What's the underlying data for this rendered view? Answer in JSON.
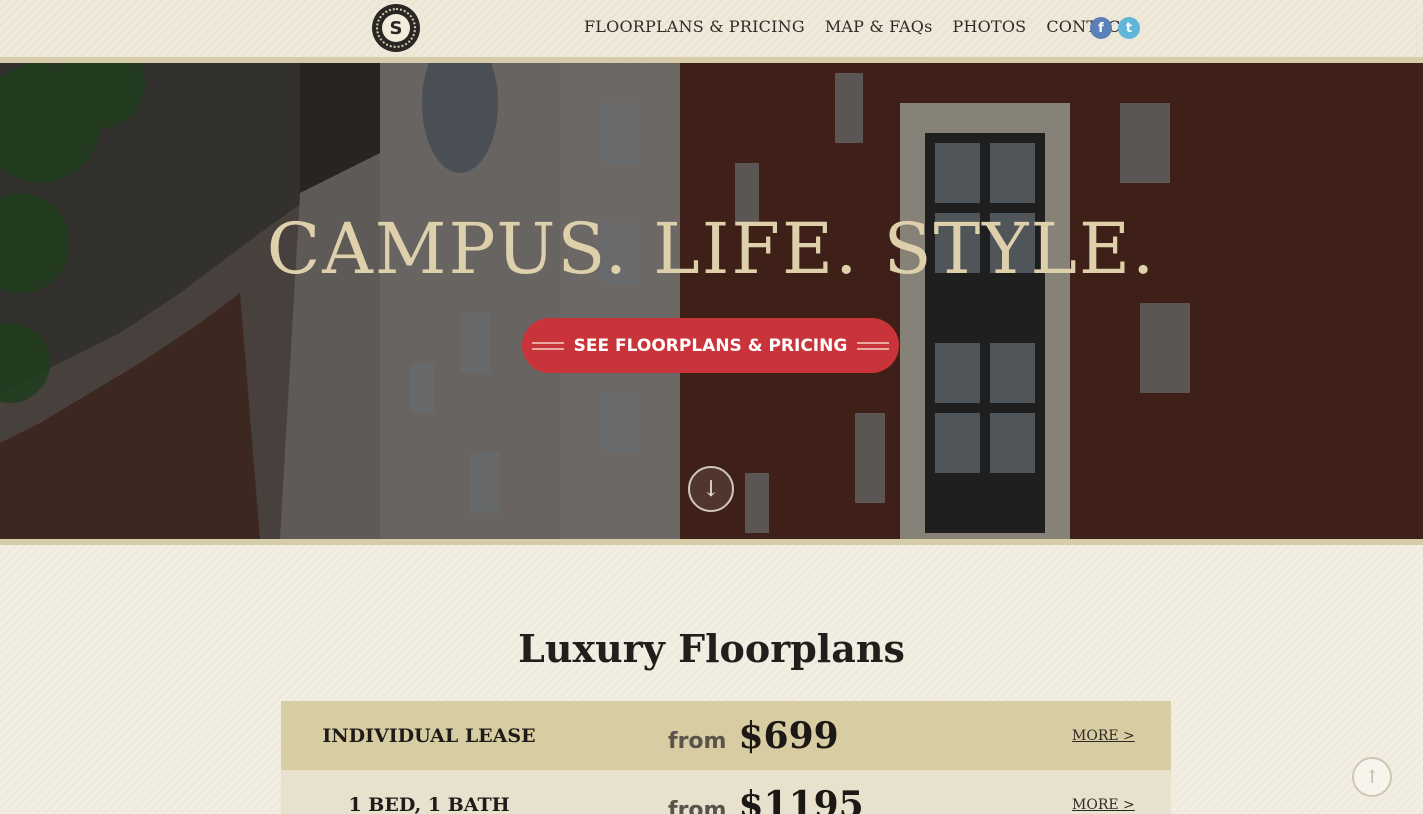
{
  "header": {
    "logo_letter": "S",
    "nav": [
      {
        "label": "FLOORPLANS & PRICING"
      },
      {
        "label": "MAP & FAQs"
      },
      {
        "label": "PHOTOS"
      },
      {
        "label": "CONTACT"
      }
    ],
    "social": {
      "facebook": "f",
      "twitter": "t"
    }
  },
  "hero": {
    "title": "CAMPUS. LIFE. STYLE.",
    "cta_label": "SEE FLOORPLANS & PRICING",
    "scroll_icon": "arrow-down-circle-icon"
  },
  "floorplans": {
    "title": "Luxury Floorplans",
    "plans": [
      {
        "name": "INDIVIDUAL LEASE",
        "from": "from",
        "price": "$699",
        "more": "MORE >"
      },
      {
        "name": "1 BED, 1 BATH",
        "from": "from",
        "price": "$1195",
        "more": "MORE >"
      }
    ]
  },
  "back_to_top_icon": "arrow-up-circle-icon",
  "colors": {
    "accent_red": "#c8343a",
    "gold": "#d8cca2",
    "cream": "#f3eee2",
    "hero_text": "#ddd0ab"
  }
}
